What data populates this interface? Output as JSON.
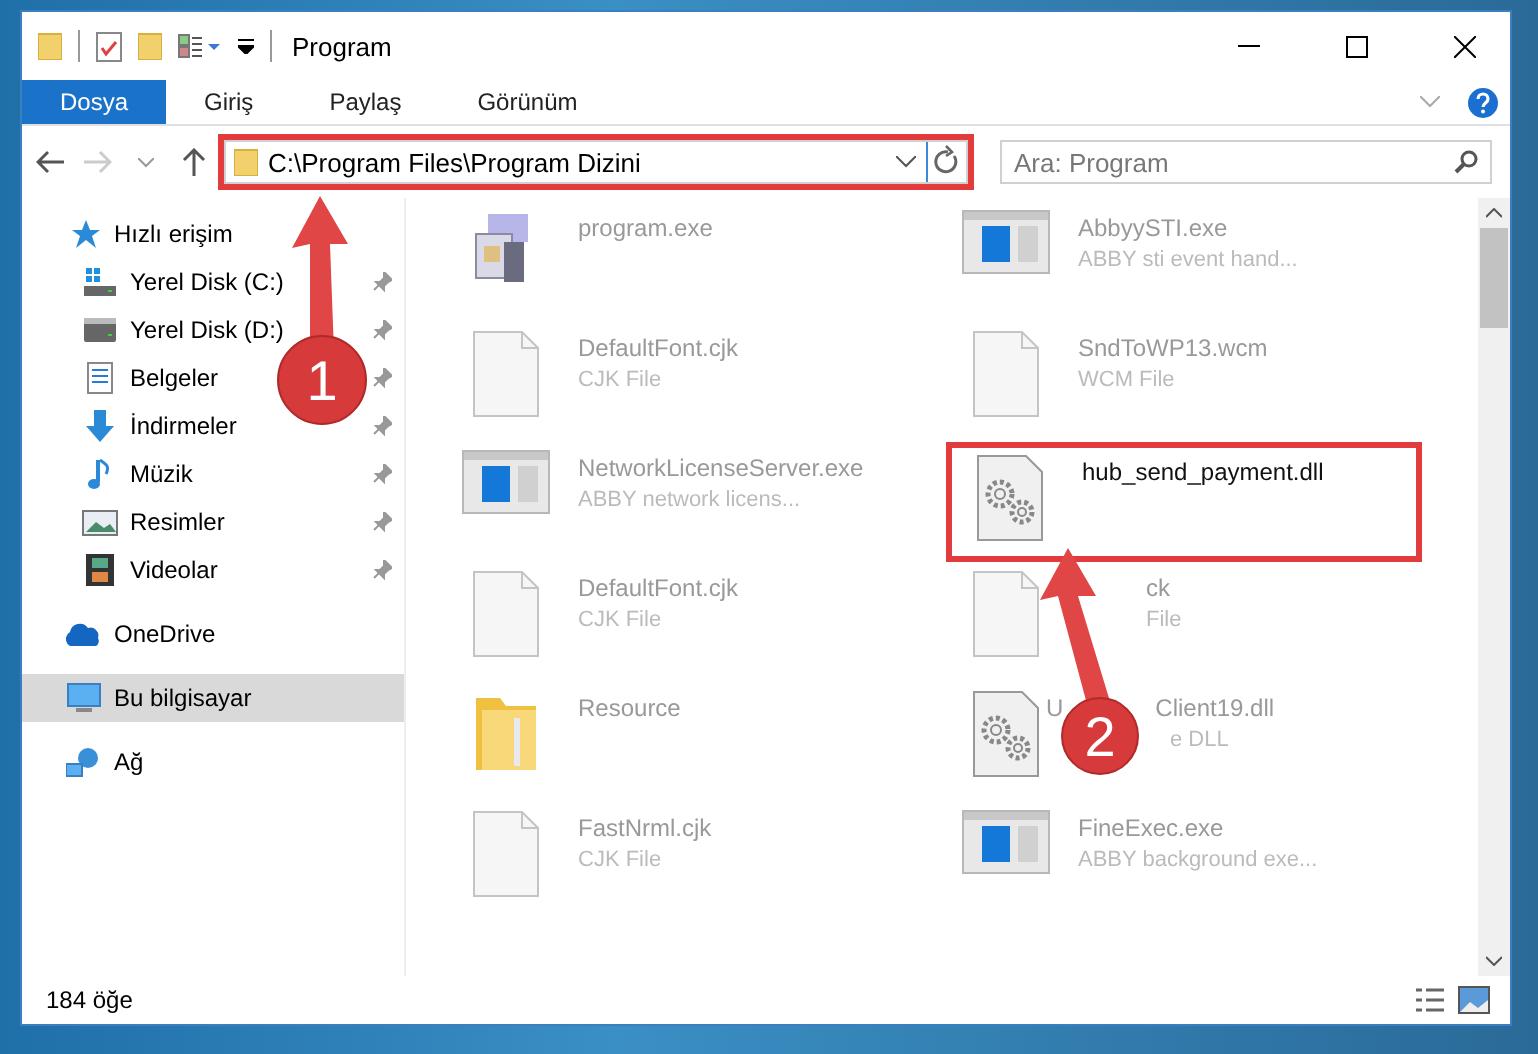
{
  "window": {
    "title": "Program"
  },
  "ribbon_tabs": [
    {
      "label": "Dosya",
      "selected": true
    },
    {
      "label": "Giriş",
      "selected": false
    },
    {
      "label": "Paylaş",
      "selected": false
    },
    {
      "label": "Görünüm",
      "selected": false
    }
  ],
  "address_bar": {
    "path": "C:\\Program Files\\Program Dizini",
    "highlighted": true
  },
  "search": {
    "placeholder": "Ara: Program"
  },
  "sidebar": {
    "items": [
      {
        "label": "Hızlı erişim",
        "selected": false,
        "children": [
          {
            "label": "Yerel Disk (C:)",
            "pinned": true
          },
          {
            "label": "Yerel Disk (D:)",
            "pinned": true
          },
          {
            "label": "Belgeler",
            "pinned": true
          },
          {
            "label": "İndirmeler",
            "pinned": true
          },
          {
            "label": "Müzik",
            "pinned": true
          },
          {
            "label": "Resimler",
            "pinned": true
          },
          {
            "label": "Videolar",
            "pinned": true
          }
        ]
      },
      {
        "label": "OneDrive",
        "selected": false
      },
      {
        "label": "Bu bilgisayar",
        "selected": true
      },
      {
        "label": "Ağ",
        "selected": false
      }
    ]
  },
  "files": [
    {
      "kind": "program",
      "name": "program.exe",
      "highlighted": false
    },
    {
      "kind": "window",
      "name": "AbbyySTI.exe",
      "type": "ABBY sti event hand...",
      "highlighted": false
    },
    {
      "kind": "doc",
      "name": "DefaultFont.cjk",
      "type": "CJK File",
      "highlighted": false
    },
    {
      "kind": "doc",
      "name": "SndToWP13.wcm",
      "type": "WCM File",
      "highlighted": false
    },
    {
      "kind": "window",
      "name": "NetworkLicenseServer.exe",
      "type": "ABBY network licens...",
      "highlighted": false
    },
    {
      "kind": "gear",
      "name": "hub_send_payment.dll",
      "highlighted": true
    },
    {
      "kind": "doc",
      "name": "DefaultFont.cjk",
      "type": "CJK File",
      "highlighted": false
    },
    {
      "kind": "doc",
      "name": "ck",
      "type": "File",
      "covered": true,
      "highlighted": false
    },
    {
      "kind": "folder",
      "name": "Resource",
      "highlighted": false
    },
    {
      "kind": "gear",
      "name": "U",
      "name_end": "Client19.dll",
      "type": "e DLL",
      "covered": true,
      "highlighted": false
    },
    {
      "kind": "doc",
      "name": "FastNrml.cjk",
      "type": "CJK File",
      "highlighted": false
    },
    {
      "kind": "window",
      "name": "FineExec.exe",
      "type": "ABBY background exe...",
      "highlighted": false
    }
  ],
  "callouts": [
    {
      "label": "1"
    },
    {
      "label": "2"
    }
  ],
  "status_bar": {
    "item_count": "184 öğe"
  }
}
